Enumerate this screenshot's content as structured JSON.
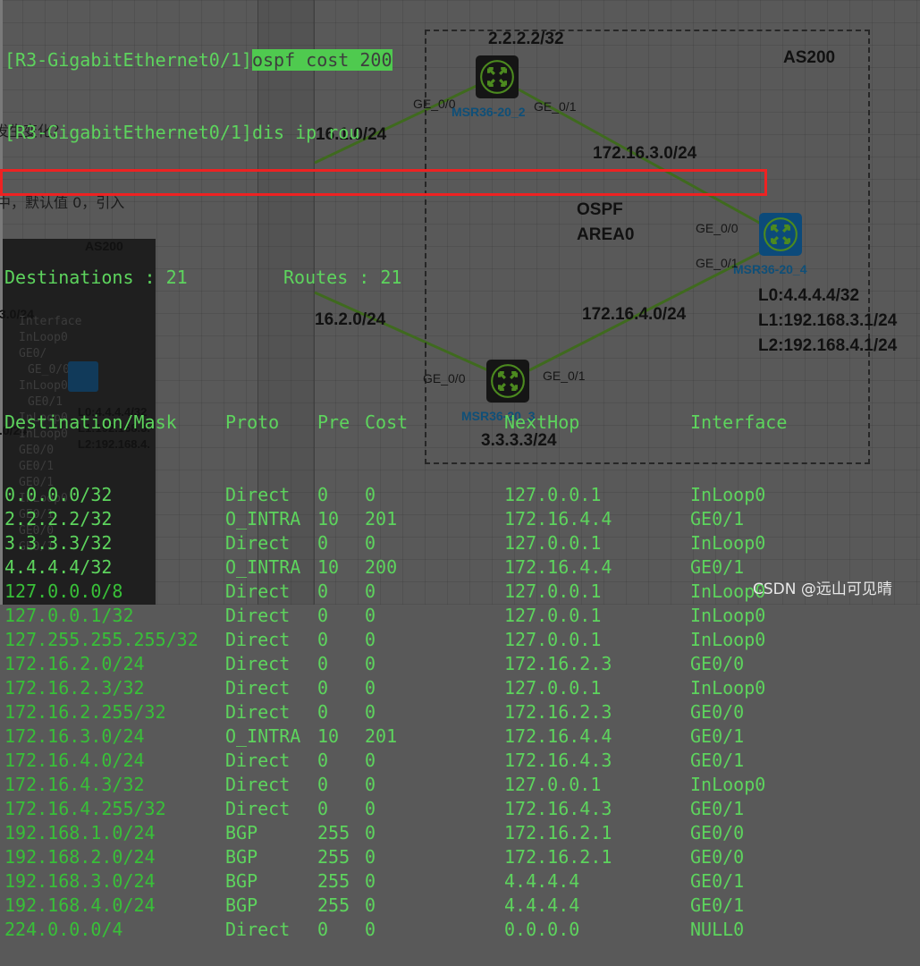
{
  "terminal": {
    "prompt": "[R3-GigabitEthernet0/1]",
    "command1": "ospf cost 200",
    "command2": "dis ip rou",
    "destinations_label": "Destinations : 21",
    "routes_label": "Routes : 21",
    "columns": [
      "Destination/Mask",
      "Proto",
      "Pre",
      "Cost",
      "NextHop",
      "Interface"
    ],
    "rows": [
      {
        "dest": "0.0.0.0/32",
        "proto": "Direct",
        "pre": "0",
        "cost": "0",
        "nexthop": "127.0.0.1",
        "iface": "InLoop0"
      },
      {
        "dest": "2.2.2.2/32",
        "proto": "O_INTRA",
        "pre": "10",
        "cost": "201",
        "nexthop": "172.16.4.4",
        "iface": "GE0/1",
        "highlighted": true
      },
      {
        "dest": "3.3.3.3/32",
        "proto": "Direct",
        "pre": "0",
        "cost": "0",
        "nexthop": "127.0.0.1",
        "iface": "InLoop0"
      },
      {
        "dest": "4.4.4.4/32",
        "proto": "O_INTRA",
        "pre": "10",
        "cost": "200",
        "nexthop": "172.16.4.4",
        "iface": "GE0/1"
      },
      {
        "dest": "127.0.0.0/8",
        "proto": "Direct",
        "pre": "0",
        "cost": "0",
        "nexthop": "127.0.0.1",
        "iface": "InLoop0"
      },
      {
        "dest": "127.0.0.1/32",
        "proto": "Direct",
        "pre": "0",
        "cost": "0",
        "nexthop": "127.0.0.1",
        "iface": "InLoop0"
      },
      {
        "dest": "127.255.255.255/32",
        "proto": "Direct",
        "pre": "0",
        "cost": "0",
        "nexthop": "127.0.0.1",
        "iface": "InLoop0"
      },
      {
        "dest": "172.16.2.0/24",
        "proto": "Direct",
        "pre": "0",
        "cost": "0",
        "nexthop": "172.16.2.3",
        "iface": "GE0/0"
      },
      {
        "dest": "172.16.2.3/32",
        "proto": "Direct",
        "pre": "0",
        "cost": "0",
        "nexthop": "127.0.0.1",
        "iface": "InLoop0"
      },
      {
        "dest": "172.16.2.255/32",
        "proto": "Direct",
        "pre": "0",
        "cost": "0",
        "nexthop": "172.16.2.3",
        "iface": "GE0/0"
      },
      {
        "dest": "172.16.3.0/24",
        "proto": "O_INTRA",
        "pre": "10",
        "cost": "201",
        "nexthop": "172.16.4.4",
        "iface": "GE0/1"
      },
      {
        "dest": "172.16.4.0/24",
        "proto": "Direct",
        "pre": "0",
        "cost": "0",
        "nexthop": "172.16.4.3",
        "iface": "GE0/1"
      },
      {
        "dest": "172.16.4.3/32",
        "proto": "Direct",
        "pre": "0",
        "cost": "0",
        "nexthop": "127.0.0.1",
        "iface": "InLoop0"
      },
      {
        "dest": "172.16.4.255/32",
        "proto": "Direct",
        "pre": "0",
        "cost": "0",
        "nexthop": "172.16.4.3",
        "iface": "GE0/1"
      },
      {
        "dest": "192.168.1.0/24",
        "proto": "BGP",
        "pre": "255",
        "cost": "0",
        "nexthop": "172.16.2.1",
        "iface": "GE0/0"
      },
      {
        "dest": "192.168.2.0/24",
        "proto": "BGP",
        "pre": "255",
        "cost": "0",
        "nexthop": "172.16.2.1",
        "iface": "GE0/0"
      },
      {
        "dest": "192.168.3.0/24",
        "proto": "BGP",
        "pre": "255",
        "cost": "0",
        "nexthop": "4.4.4.4",
        "iface": "GE0/1"
      },
      {
        "dest": "192.168.4.0/24",
        "proto": "BGP",
        "pre": "255",
        "cost": "0",
        "nexthop": "4.4.4.4",
        "iface": "GE0/1"
      },
      {
        "dest": "224.0.0.0/4",
        "proto": "Direct",
        "pre": "0",
        "cost": "0",
        "nexthop": "0.0.0.0",
        "iface": "NULL0"
      }
    ]
  },
  "topology": {
    "as_label": "AS200",
    "area_label_1": "OSPF",
    "area_label_2": "AREA0",
    "routers": [
      {
        "name": "MSR36-20_2",
        "loopback": "2.2.2.2/32",
        "icon": "router-icon"
      },
      {
        "name": "MSR36-20_3",
        "loopback": "3.3.3.3/24",
        "icon": "router-icon"
      },
      {
        "name": "MSR36-20_4",
        "loopbacks": [
          "L0:4.4.4.4/32",
          "L1:192.168.3.1/24",
          "L2:192.168.4.1/24"
        ],
        "icon": "router-icon"
      }
    ],
    "links": [
      {
        "network": "16.1.0/24"
      },
      {
        "network": "16.2.0/24"
      },
      {
        "network": "172.16.3.0/24"
      },
      {
        "network": "172.16.4.0/24"
      }
    ],
    "ports": {
      "r2_ge00": "GE_0/0",
      "r2_ge01": "GE_0/1",
      "r3_ge00": "GE_0/0",
      "r3_ge01": "GE_0/1",
      "r4_ge00": "GE_0/0",
      "r4_ge01": "GE_0/1"
    }
  },
  "background": {
    "doc_text_1": "发生变化？",
    "doc_text_2": "中，默认值 0，引入",
    "under_as_label": "AS200",
    "under_net_1": "3.0/24",
    "under_net_2": ".0/24",
    "under_ghost_lines": [
      "Interface",
      "InLoop0",
      "GE0/",
      "GE_0/0",
      "InLoop0",
      "GE0/1",
      "InLoop0",
      "InLoop0",
      "GE0/0",
      "GE0/1",
      "GE0/1",
      "InLoop0",
      "GE0/1",
      "GE0/0",
      "GE0/1"
    ],
    "under_loop_1": "L0:4.4.4.4/32",
    "under_loop_2": "L1:192.168.3.",
    "under_loop_3": "L2:192.168.4."
  },
  "watermark": "CSDN @远山可见晴",
  "colors": {
    "terminal_text": "#5dd45d",
    "highlight_bg": "#4fca4f",
    "redbox": "#ee2222",
    "link": "#3f6a1e",
    "router_name": "#0f4f78"
  }
}
